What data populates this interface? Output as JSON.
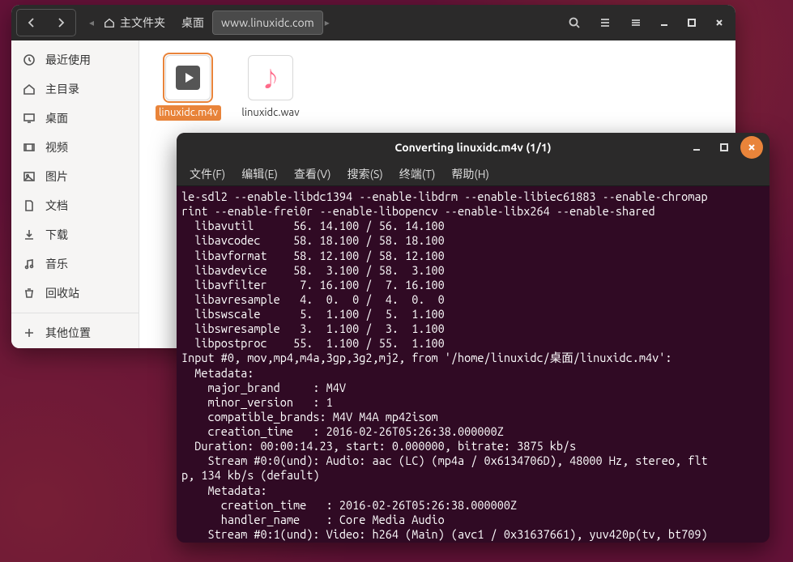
{
  "file_manager": {
    "path": {
      "home_label": "主文件夹",
      "desktop_label": "桌面",
      "current_label": "www.linuxidc.com"
    },
    "sidebar": [
      {
        "icon": "clock",
        "label": "最近使用"
      },
      {
        "icon": "home",
        "label": "主目录"
      },
      {
        "icon": "desk",
        "label": "桌面"
      },
      {
        "icon": "video",
        "label": "视频"
      },
      {
        "icon": "image",
        "label": "图片"
      },
      {
        "icon": "doc",
        "label": "文档"
      },
      {
        "icon": "down",
        "label": "下载"
      },
      {
        "icon": "music",
        "label": "音乐"
      },
      {
        "icon": "trash",
        "label": "回收站"
      },
      {
        "icon": "plus",
        "label": "其他位置"
      }
    ],
    "files": [
      {
        "name": "linuxidc.m4v",
        "kind": "video",
        "selected": true
      },
      {
        "name": "linuxidc.wav",
        "kind": "audio",
        "selected": false
      }
    ]
  },
  "terminal": {
    "title": "Converting linuxidc.m4v (1/1)",
    "menu": [
      "文件(F)",
      "编辑(E)",
      "查看(V)",
      "搜索(S)",
      "终端(T)",
      "帮助(H)"
    ],
    "output": "le-sdl2 --enable-libdc1394 --enable-libdrm --enable-libiec61883 --enable-chromap\nrint --enable-frei0r --enable-libopencv --enable-libx264 --enable-shared\n  libavutil      56. 14.100 / 56. 14.100\n  libavcodec     58. 18.100 / 58. 18.100\n  libavformat    58. 12.100 / 58. 12.100\n  libavdevice    58.  3.100 / 58.  3.100\n  libavfilter     7. 16.100 /  7. 16.100\n  libavresample   4.  0.  0 /  4.  0.  0\n  libswscale      5.  1.100 /  5.  1.100\n  libswresample   3.  1.100 /  3.  1.100\n  libpostproc    55.  1.100 / 55.  1.100\nInput #0, mov,mp4,m4a,3gp,3g2,mj2, from '/home/linuxidc/桌面/linuxidc.m4v':\n  Metadata:\n    major_brand     : M4V\n    minor_version   : 1\n    compatible_brands: M4V M4A mp42isom\n    creation_time   : 2016-02-26T05:26:38.000000Z\n  Duration: 00:00:14.23, start: 0.000000, bitrate: 3875 kb/s\n    Stream #0:0(und): Audio: aac (LC) (mp4a / 0x6134706D), 48000 Hz, stereo, flt\np, 134 kb/s (default)\n    Metadata:\n      creation_time   : 2016-02-26T05:26:38.000000Z\n      handler_name    : Core Media Audio\n    Stream #0:1(und): Video: h264 (Main) (avc1 / 0x31637661), yuv420p(tv, bt709)"
  }
}
